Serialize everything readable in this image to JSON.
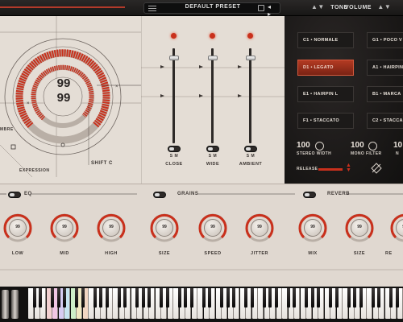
{
  "topbar": {
    "preset_name": "DEFAULT PRESET",
    "tone_label": "TONE",
    "volume_label": "VOLUME",
    "tone_arrows": "▲▼",
    "volume_arrows": "▲▼",
    "preset_nav": "◂ ▸"
  },
  "dial": {
    "value_top": "99",
    "value_bottom": "99",
    "timbre_label": "MBRE",
    "expression_label": "EXPRESSION",
    "shift_label": "SHIFT C"
  },
  "faders": [
    {
      "label": "CLOSE",
      "toggle_label": "S M",
      "level": 0.92
    },
    {
      "label": "WIDE",
      "toggle_label": "S M",
      "level": 0.92
    },
    {
      "label": "AMBIENT",
      "toggle_label": "S M",
      "level": 0.92
    }
  ],
  "articulations": {
    "left": [
      "C1 • NORMALE",
      "D1 • LEGATO",
      "E1 • HAIRPIN L",
      "F1 • STACCATO"
    ],
    "right": [
      "G1 • POCO V",
      "A1 • HAIRPIN",
      "B1 • MARCA",
      "C2 • STACCA"
    ],
    "active_index": 1
  },
  "mixer": {
    "stereo_width_value": "100",
    "stereo_width_label": "STEREO WIDTH",
    "mono_filter_value": "100",
    "mono_filter_label": "MONO FILTER",
    "extra_value": "10",
    "extra_label": "N",
    "release_label": "RELEASE"
  },
  "effects": {
    "eq_label": "EQ",
    "grains_label": "GRAINS",
    "reverb_label": "REVERB",
    "knobs": [
      {
        "label": "LOW",
        "value": "99"
      },
      {
        "label": "MID",
        "value": "99"
      },
      {
        "label": "HIGH",
        "value": "99"
      },
      {
        "label": "SIZE",
        "value": "99"
      },
      {
        "label": "SPEED",
        "value": "99"
      },
      {
        "label": "JITTER",
        "value": "99"
      },
      {
        "label": "MIX",
        "value": "99"
      },
      {
        "label": "SIZE",
        "value": "99"
      },
      {
        "label": "RE",
        "value": "99"
      }
    ]
  },
  "colors": {
    "accent_red": "#c9301c",
    "panel_light": "#e4ddd5",
    "panel_dark": "#161413"
  }
}
